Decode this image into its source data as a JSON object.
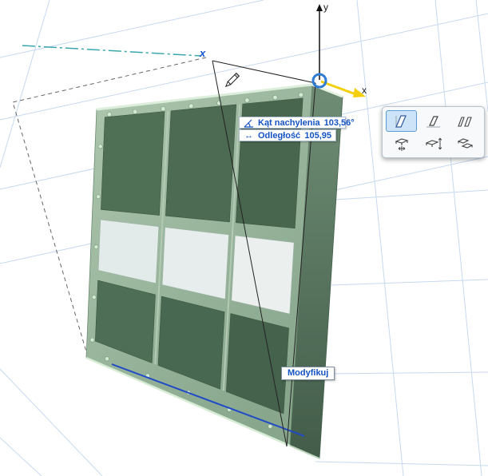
{
  "viewport": {
    "axis_y_label": "y",
    "axis_x_label": "x",
    "edit_marker_label": "x"
  },
  "tracker": {
    "rows": [
      {
        "icon": "angle-icon",
        "label": "Kąt nachylenia",
        "value": "103,56°"
      },
      {
        "icon": "distance-arrow-icon",
        "label": "Odległość",
        "value": "105,95"
      }
    ]
  },
  "modify": {
    "label": "Modyfikuj"
  },
  "palette": {
    "selected_index": 0,
    "items": [
      {
        "icon": "tilt-panel-icon"
      },
      {
        "icon": "tilt-panel-baseline-icon"
      },
      {
        "icon": "tilt-panels-pair-icon"
      },
      {
        "icon": "move-slab-arrows-icon"
      },
      {
        "icon": "elevate-slab-icon"
      },
      {
        "icon": "offset-slabs-icon"
      }
    ]
  },
  "colors": {
    "accent_blue": "#1453c4",
    "selection_ring_blue": "#2e7cd6",
    "axis_yellow": "#f3cf0e",
    "frame_green": "#9ab89d",
    "panel_green": "#4c6b52",
    "window_grey": "#e7edec",
    "grid_blue": "#c7d9f0",
    "guide_teal": "#3aa7ac",
    "edge_highlight_blue": "#1f49c7"
  }
}
